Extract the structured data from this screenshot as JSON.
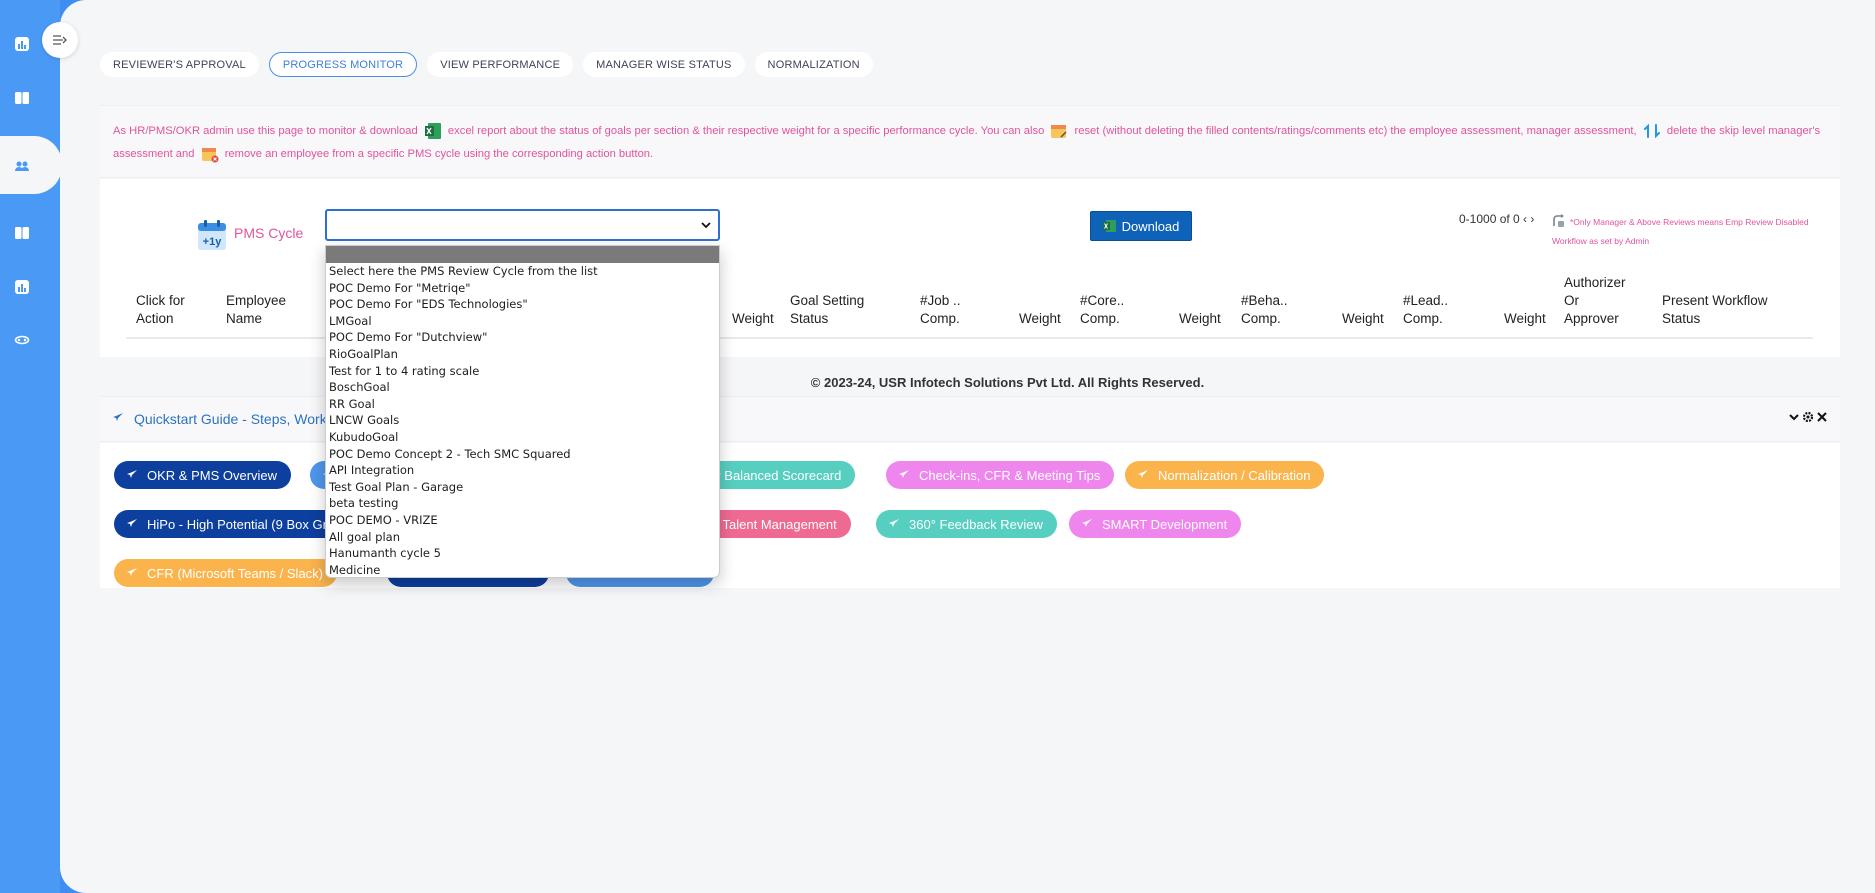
{
  "tabs": [
    {
      "label": "REVIEWER'S APPROVAL",
      "active": false
    },
    {
      "label": "PROGRESS MONITOR",
      "active": true
    },
    {
      "label": "VIEW PERFORMANCE",
      "active": false
    },
    {
      "label": "MANAGER WISE STATUS",
      "active": false
    },
    {
      "label": "NORMALIZATION",
      "active": false
    }
  ],
  "info": {
    "part1": "As HR/PMS/OKR admin use this page to monitor & download",
    "part2": "excel report about the status of goals per section & their respective weight for a specific performance cycle. You can also",
    "part3": "reset (without deleting the filled contents/ratings/comments etc) the employee assessment, manager assessment,",
    "part4": "delete the skip level manager's assessment and",
    "part5": "remove an employee from a specific PMS cycle using the corresponding action button."
  },
  "filter": {
    "pms_label": "PMS Cycle",
    "download_label": "Download",
    "pager": "0-1000 of 0 ‹ ›",
    "note": "*Only Manager & Above Reviews means Emp Review Disabled Workflow as set by Admin"
  },
  "table_headers": [
    "Click for Action",
    "Employee Name",
    "Weight",
    "Goal Setting Status",
    "#Job .. Comp.",
    "Weight",
    "#Core.. Comp.",
    "Weight",
    "#Beha.. Comp.",
    "Weight",
    "#Lead.. Comp.",
    "Weight",
    "Authorizer Or Approver",
    "Present Workflow Status"
  ],
  "dropdown_options": [
    "",
    "Select here the PMS Review Cycle from the list",
    "POC Demo For \"Metriqe\"",
    "POC Demo For \"EDS Technologies\"",
    "LMGoal",
    "POC Demo For \"Dutchview\"",
    "RioGoalPlan",
    "Test for 1 to 4 rating scale",
    "BoschGoal",
    "RR Goal",
    "LNCW Goals",
    "KubudoGoal",
    "POC Demo Concept 2 - Tech SMC Squared",
    "API Integration",
    "Test Goal Plan - Garage",
    "beta testing",
    "POC DEMO - VRIZE",
    "All goal plan",
    "Hanumanth cycle 5",
    "Medicine"
  ],
  "footer": "© 2023-24, USR Infotech Solutions Pvt Ltd. All Rights Reserved.",
  "quickstart": {
    "title": "Quickstart Guide - Steps, Workf",
    "pills": [
      {
        "label": "OKR & PMS Overview",
        "color": "#0d3f9e"
      },
      {
        "label": "- by Balanced Scorecard",
        "color": "#56cfc1"
      },
      {
        "label": "Check-ins, CFR & Meeting Tips",
        "color": "#ee86ee"
      },
      {
        "label": "Normalization / Calibration",
        "color": "#fbb34c"
      },
      {
        "label": "HiPo - High Potential (9 Box Gri",
        "color": "#0d3f9e"
      },
      {
        "label": "for Talent Management",
        "color": "#ef6a93"
      },
      {
        "label": "360° Feedback Review",
        "color": "#56cfc1"
      },
      {
        "label": "SMART Development",
        "color": "#ee86ee"
      },
      {
        "label": "CFR (Microsoft Teams / Slack)",
        "color": "#fbb34c"
      }
    ]
  },
  "colors": {
    "accent": "#4a9af5",
    "pink": "#e0549c",
    "download": "#0e63b8"
  }
}
